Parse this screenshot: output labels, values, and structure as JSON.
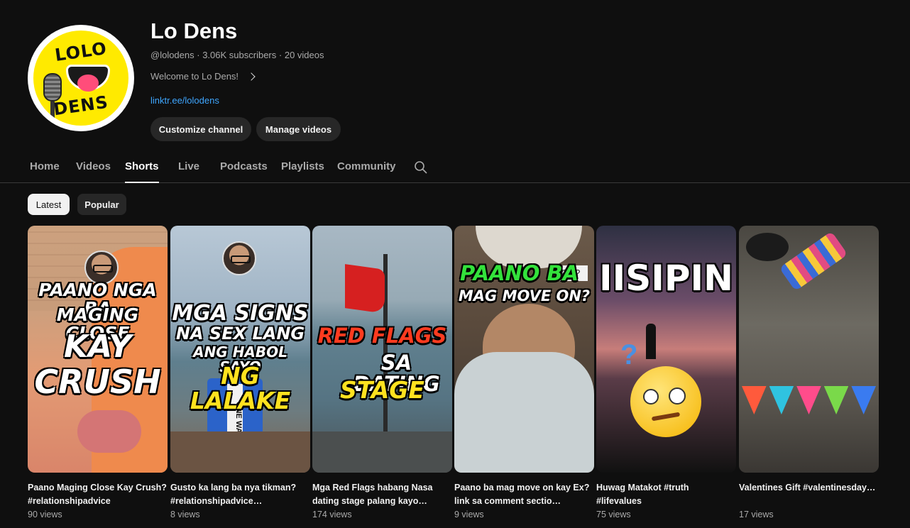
{
  "channel": {
    "name": "Lo Dens",
    "handle": "@lolodens",
    "subscribers": "3.06K subscribers",
    "videos": "20 videos",
    "description": "Welcome to Lo Dens!",
    "link": "linktr.ee/lolodens",
    "logo_top": "LOLO",
    "logo_bottom": "DENS"
  },
  "buttons": {
    "customize": "Customize channel",
    "manage": "Manage videos"
  },
  "tabs": [
    "Home",
    "Videos",
    "Shorts",
    "Live",
    "Podcasts",
    "Playlists",
    "Community"
  ],
  "active_tab": "Shorts",
  "chips": {
    "latest": "Latest",
    "popular": "Popular"
  },
  "shorts": [
    {
      "title": "Paano Maging Close Kay Crush? #relationshipadvice",
      "views": "90 views",
      "overlay": [
        "PAANO NGA BA",
        "MAGING CLOSE",
        "KAY",
        "CRUSH"
      ]
    },
    {
      "title": "Gusto ka lang ba nya tikman? #relationshipadvice…",
      "views": "8 views",
      "overlay": [
        "MGA SIGNS",
        "NA SEX LANG",
        "ANG HABOL SAYO",
        "NG LALAKE"
      ],
      "sign": "ONE WAY"
    },
    {
      "title": "Mga Red Flags habang Nasa dating stage palang kayo…",
      "views": "174 views",
      "overlay": [
        "RED FLAGS",
        "SA DATING",
        "STAGE"
      ]
    },
    {
      "title": "Paano ba mag move on kay Ex? link sa comment sectio…",
      "views": "9 views",
      "overlay": [
        "PAANO BA",
        "MAG MOVE ON?"
      ],
      "bubble": "ON?"
    },
    {
      "title": "Huwag Matakot #truth #lifevalues",
      "views": "75 views",
      "overlay": [
        "IISIPIN"
      ],
      "qmark": "?"
    },
    {
      "title": "Valentines Gift #valentinesday…",
      "views": "17 views"
    }
  ],
  "colors": {
    "link": "#3ea6ff",
    "background": "#0f0f0f",
    "chip_active": "#f1f1f1",
    "chip": "#272727"
  }
}
